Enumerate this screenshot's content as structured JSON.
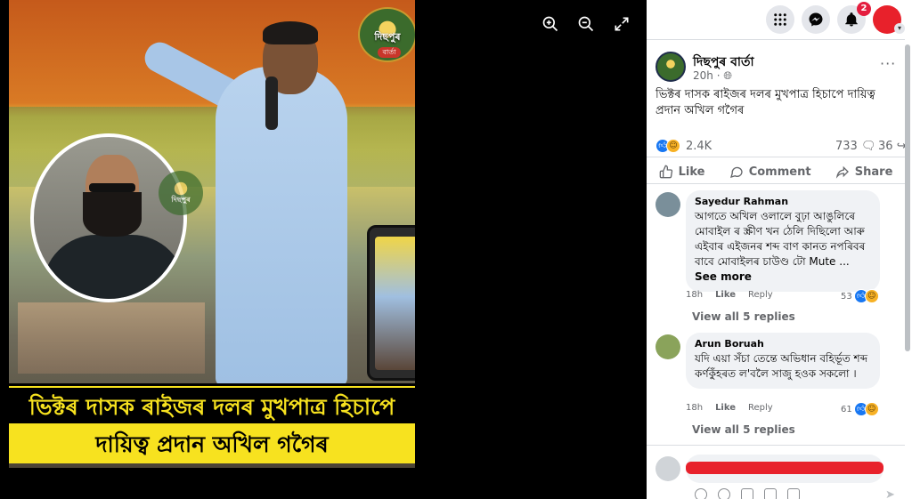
{
  "viewer": {
    "logo_text": "দিছপুৰ",
    "logo_sub": "বাৰ্তা",
    "banner_line1": "ভিক্টৰ দাসক ৰাইজৰ দলৰ মুখপাত্ৰ হিচাপে",
    "banner_line2": "দায়িত্ব প্ৰদান অখিল গগৈৰ",
    "tools": [
      "zoom-in-icon",
      "zoom-out-icon",
      "fullscreen-icon"
    ]
  },
  "topbar": {
    "notification_count": "2"
  },
  "post": {
    "page_name": "দিছপুৰ বাৰ্তা",
    "time": "20h ·",
    "more": "···",
    "text": "ভিক্টৰ দাসক ৰাইজৰ দলৰ মুখপাত্ৰ হিচাপে দায়িত্ব প্ৰদান অখিল গগৈৰ",
    "reaction_count": "2.4K",
    "comment_count": "733",
    "share_count": "36",
    "actions": {
      "like": "Like",
      "comment": "Comment",
      "share": "Share"
    }
  },
  "comments": [
    {
      "name": "Sayedur Rahman",
      "text": "আগতে অখিল ওলালে বুঢ়া আঙুলিৰে মোবাইল ৰ স্ক্ৰীণ খন ঠেলি দিছিলো আৰু এইবাৰ এইজনৰ শব্দ বাণ কানত নপৰিবৰ বাবে মোবাইলৰ চাউণ্ড টো Mute ...",
      "see_more": "See more",
      "time": "18h",
      "like": "Like",
      "reply": "Reply",
      "reaction_count": "53",
      "view_replies": "View all 5 replies"
    },
    {
      "name": "Arun Boruah",
      "text": "যদি এয়া সঁচা তেন্তে অভিধান বহিৰ্ভূত শব্দ কৰ্ণকুঁহৰত ল'বলৈ সাজু হওক সকলো ।",
      "time": "18h",
      "like": "Like",
      "reply": "Reply",
      "reaction_count": "61",
      "view_replies": "View all 5 replies"
    }
  ]
}
